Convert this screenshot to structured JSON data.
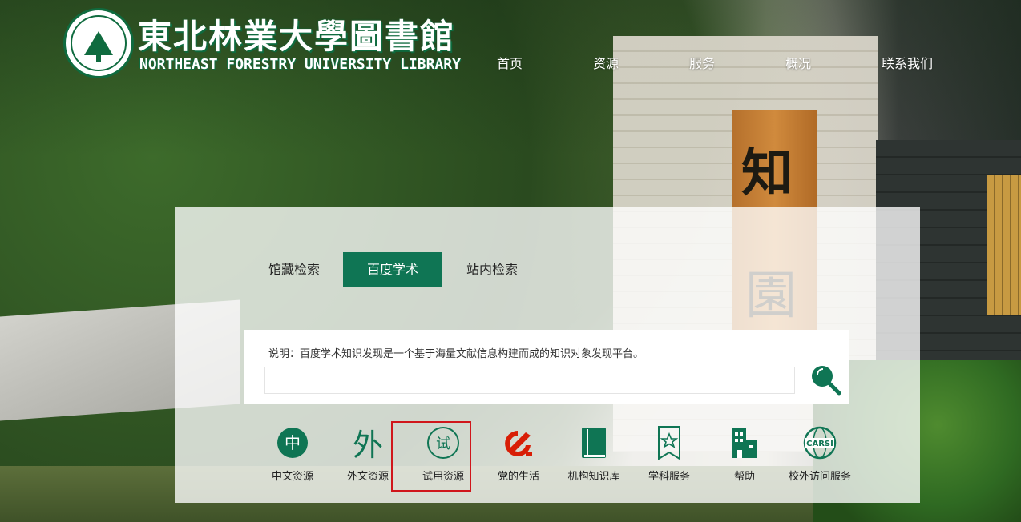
{
  "header": {
    "brand_cn": "東北林業大學圖書館",
    "brand_en": "NORTHEAST FORESTRY UNIVERSITY LIBRARY",
    "nav": [
      "首页",
      "资源",
      "服务",
      "概况",
      "联系我们"
    ]
  },
  "scene": {
    "sign_char_1": "知",
    "sign_char_2": "園"
  },
  "search": {
    "tabs": [
      "馆藏检索",
      "百度学术",
      "站内检索"
    ],
    "active_tab": "百度学术",
    "note": "说明：百度学术知识发现是一个基于海量文献信息构建而成的知识对象发现平台。",
    "input_value": "",
    "search_icon": "magnifier-icon"
  },
  "quick_links": [
    {
      "label": "中文资源",
      "icon": "zhong-icon",
      "glyph": "中"
    },
    {
      "label": "外文资源",
      "icon": "wai-icon",
      "glyph": "外"
    },
    {
      "label": "试用资源",
      "icon": "shi-icon",
      "glyph": "试"
    },
    {
      "label": "党的生活",
      "icon": "party-emblem-icon"
    },
    {
      "label": "机构知识库",
      "icon": "book-icon"
    },
    {
      "label": "学科服务",
      "icon": "bookmark-star-icon"
    },
    {
      "label": "帮助",
      "icon": "building-icon"
    },
    {
      "label": "校外访问服务",
      "icon": "carsi-globe-icon",
      "glyph": "CARSI"
    }
  ],
  "highlighted_link": "试用资源",
  "colors": {
    "primary": "#0f7554",
    "highlight": "#d0161b",
    "party": "#d81e06"
  }
}
